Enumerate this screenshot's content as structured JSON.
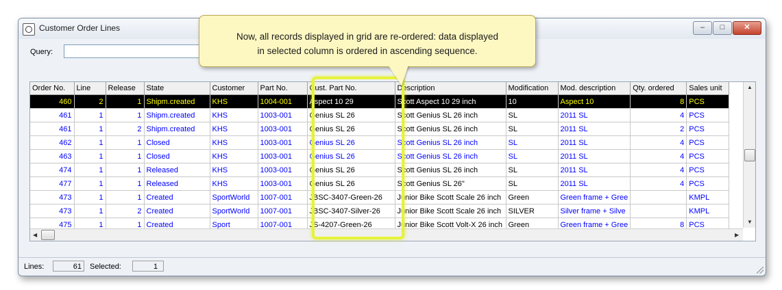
{
  "window": {
    "title": "Customer Order Lines"
  },
  "query": {
    "label": "Query:",
    "value": ""
  },
  "grid": {
    "columns": [
      "Order No.",
      "Line",
      "Release",
      "State",
      "Customer",
      "Part No.",
      "Cust. Part No.",
      "Description",
      "Modification",
      "Mod. description",
      "Qty. ordered",
      "Sales unit"
    ],
    "rows": [
      [
        "460",
        "2",
        "1",
        "Shipm.created",
        "KHS",
        "1004-001",
        "Aspect 10 29",
        "Scott Aspect 10 29 inch",
        "10",
        "Aspect 10",
        "8",
        "PCS"
      ],
      [
        "461",
        "1",
        "1",
        "Shipm.created",
        "KHS",
        "1003-001",
        "Genius SL 26",
        "Scott Genius SL 26 inch",
        "SL",
        "2011 SL",
        "4",
        "PCS"
      ],
      [
        "461",
        "1",
        "2",
        "Shipm.created",
        "KHS",
        "1003-001",
        "Genius SL 26",
        "Scott Genius SL 26 inch",
        "SL",
        "2011 SL",
        "2",
        "PCS"
      ],
      [
        "462",
        "1",
        "1",
        "Closed",
        "KHS",
        "1003-001",
        "Genius SL 26",
        "Scott Genius SL 26 inch",
        "SL",
        "2011 SL",
        "4",
        "PCS"
      ],
      [
        "463",
        "1",
        "1",
        "Closed",
        "KHS",
        "1003-001",
        "Genius SL 26",
        "Scott Genius SL 26 inch",
        "SL",
        "2011 SL",
        "4",
        "PCS"
      ],
      [
        "474",
        "1",
        "1",
        "Released",
        "KHS",
        "1003-001",
        "Genius SL 26",
        "Scott Genius SL 26 inch",
        "SL",
        "2011 SL",
        "4",
        "PCS"
      ],
      [
        "477",
        "1",
        "1",
        "Released",
        "KHS",
        "1003-001",
        "Genius SL 26",
        "Scott Genius SL 26\"",
        "SL",
        "2011 SL",
        "4",
        "PCS"
      ],
      [
        "473",
        "1",
        "1",
        "Created",
        "SportWorld",
        "1007-001",
        "JBSC-3407-Green-26",
        "Junior Bike Scott Scale 26 inch",
        "Green",
        "Green frame + Gree",
        "",
        "KMPL"
      ],
      [
        "473",
        "1",
        "2",
        "Created",
        "SportWorld",
        "1007-001",
        "JBSC-3407-Silver-26",
        "Junior Bike Scott Scale 26 inch",
        "SILVER",
        "Silver frame + Silve",
        "",
        "KMPL"
      ],
      [
        "475",
        "1",
        "1",
        "Created",
        "Sport",
        "1007-001",
        "JS-4207-Green-26",
        "Junior Bike Scott Volt-X 26 inch",
        "Green",
        "Green frame + Gree",
        "8",
        "PCS"
      ]
    ],
    "selected_row": 0
  },
  "status": {
    "lines_label": "Lines:",
    "lines_value": "61",
    "selected_label": "Selected:",
    "selected_value": "1"
  },
  "callout": {
    "line1": "Now, all records displayed in grid are re-ordered: data displayed",
    "line2": "in selected column is ordered in ascending sequence."
  },
  "colors": {
    "selection_bg": "#000000",
    "selection_text": "#ffff00",
    "link_blue": "#0000ff",
    "callout_bg": "#fdf8c2",
    "highlight": "#e6f23c"
  }
}
